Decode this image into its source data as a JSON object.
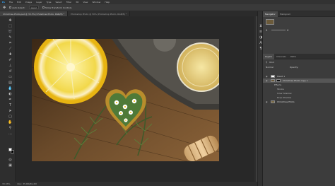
{
  "app": {
    "name": "Photoshop"
  },
  "menu": [
    "File",
    "Edit",
    "Image",
    "Layer",
    "Type",
    "Select",
    "Filter",
    "3D",
    "View",
    "Window",
    "Help"
  ],
  "options": {
    "auto_select_label": "Auto-Select:",
    "auto_select_value": "Layer",
    "show_transform_label": "Show Transform Controls"
  },
  "documents": [
    {
      "label": "Christmas Photo.psd @ 33.3% (Christmas Photo, RGB/8) *"
    },
    {
      "label": "Photoshop Photo @ 50% (Photoshop Photo, RGB/8) *"
    }
  ],
  "status": {
    "zoom": "33.33%",
    "doc": "Doc: 35.6M/69.2M"
  },
  "panels": {
    "top_tabs": [
      "Navigator",
      "Histogram"
    ],
    "layer_tabs": [
      "Layers",
      "Channels",
      "Paths"
    ],
    "kind_label": "Kind",
    "normal_label": "Normal",
    "opacity_label": "Opacity:",
    "layers": [
      {
        "name": "Heart 1",
        "selected": false
      },
      {
        "name": "Christmas Photo copy 1",
        "selected": true
      },
      {
        "name": "Effects",
        "selected": false
      },
      {
        "name": "Stroke",
        "selected": false
      },
      {
        "name": "Inner Shadow",
        "selected": false
      },
      {
        "name": "Drop Shadow",
        "selected": false
      },
      {
        "name": "Christmas Photo",
        "selected": false
      }
    ]
  },
  "colors": {
    "foreground": "#ffffff",
    "background": "#000000",
    "accent": "#3d6fb8"
  }
}
